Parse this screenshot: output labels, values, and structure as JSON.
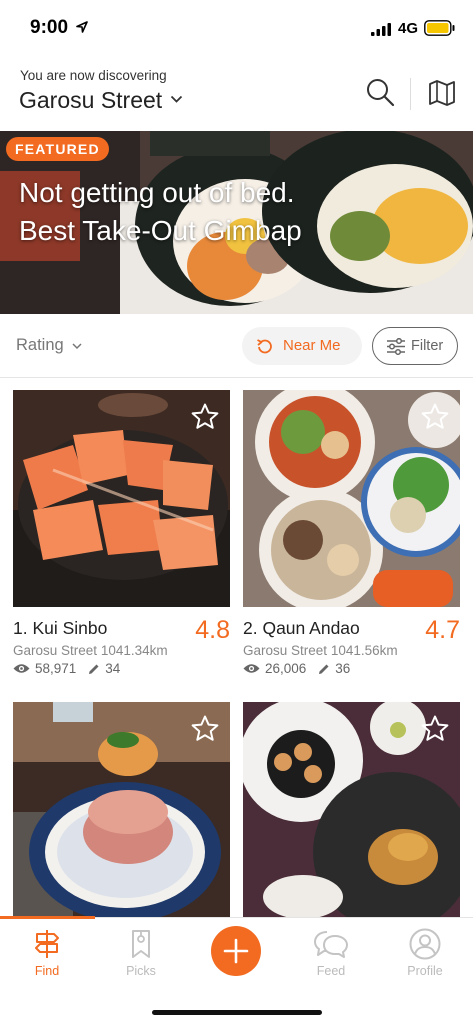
{
  "status_bar": {
    "time": "9:00",
    "network": "4G"
  },
  "header": {
    "subtitle": "You are now discovering",
    "location": "Garosu Street",
    "search_icon": "search-icon",
    "map_icon": "map-icon"
  },
  "banner": {
    "tag": "FEATURED",
    "line1": "Not getting out of bed.",
    "line2": "Best Take-Out Gimbap"
  },
  "filters": {
    "sort_label": "Rating",
    "near_me_label": "Near Me",
    "filter_label": "Filter"
  },
  "places": [
    {
      "name": "1. Kui Sinbo",
      "rating": "4.8",
      "location": "Garosu Street",
      "distance": "1041.34km",
      "views": "58,971",
      "edits": "34"
    },
    {
      "name": "2. Qaun Andao",
      "rating": "4.7",
      "location": "Garosu Street",
      "distance": "1041.56km",
      "views": "26,006",
      "edits": "36"
    },
    {
      "name": "",
      "rating": "",
      "location": "",
      "distance": "",
      "views": "",
      "edits": ""
    },
    {
      "name": "",
      "rating": "",
      "location": "",
      "distance": "",
      "views": "",
      "edits": ""
    }
  ],
  "tabs": [
    {
      "label": "Find",
      "icon": "signpost-icon",
      "active": true
    },
    {
      "label": "Picks",
      "icon": "bookmark-icon",
      "active": false
    },
    {
      "label": "",
      "icon": "plus-icon",
      "active": false
    },
    {
      "label": "Feed",
      "icon": "chat-bubbles-icon",
      "active": false
    },
    {
      "label": "Profile",
      "icon": "profile-icon",
      "active": false
    }
  ],
  "theme": {
    "accent": "#f26b21",
    "muted": "#888888"
  }
}
